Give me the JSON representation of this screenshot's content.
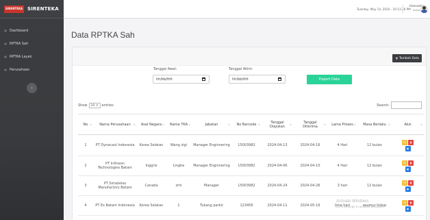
{
  "brand": {
    "logo_line1": "SIRENTEKA",
    "logo_line2": "",
    "name": "SIRENTEKA"
  },
  "sidebar": {
    "items": [
      {
        "label": "Dashboard",
        "icon": "circle-icon"
      },
      {
        "label": "RPTKA Sah",
        "icon": "circle-icon"
      },
      {
        "label": "RPTKA Layak",
        "icon": "circle-icon"
      },
      {
        "label": "Perusahaan",
        "icon": "circle-icon"
      }
    ],
    "collapse_glyph": "‹"
  },
  "topbar": {
    "date": "Tuesday, May 14, 2024 - 10:13:28 PM",
    "user_name": "Hasnadan",
    "user_role": "Admin"
  },
  "page": {
    "title": "Data RPTKA Sah"
  },
  "toolbar": {
    "add_label": "Tambah Data",
    "add_glyph": "+"
  },
  "filters": {
    "start_label": "Tanggal Awal:",
    "start_placeholder": "hh/bb/tttt",
    "end_label": "Tanggal Akhir:",
    "end_placeholder": "hh/bb/tttt",
    "export_label": "Export Data"
  },
  "table_controls": {
    "show_label": "Show",
    "entries_value": "10",
    "entries_label": "entries",
    "search_label": "Search:"
  },
  "table": {
    "headers": [
      "No",
      "Nama Perusahaan",
      "Asal Negara",
      "Nama TKA",
      "Jabatan",
      "No Barcode",
      "Tanggal Diajukan",
      "Tanggal Diterima",
      "Lama Proses",
      "Masa Berlaku",
      "Aksi"
    ],
    "rows": [
      [
        "1",
        "PT Dynacast Indonesia",
        "Korea Selatan",
        "Wang zigi",
        "Manager Enginnering",
        "15003982",
        "2024-04-13",
        "2024-04-16",
        "4 Hari",
        "12 bulan"
      ],
      [
        "2",
        "PT Infineon Technologies Batam",
        "Inggris",
        "Linghe",
        "Manager Enginnering",
        "15003982",
        "2024-04-06",
        "2024-04-10",
        "4 Hari",
        "12 bulan"
      ],
      [
        "3",
        "PT Simatelex Manufactory Batam",
        "Canada",
        "zml",
        "Manager",
        "15003982",
        "2024-04-24",
        "2024-04-26",
        "3 hari",
        "12 bulan"
      ],
      [
        "4",
        "PT Ex Batam Indonesia",
        "Korea Selatan",
        "1",
        "Tukang parkir",
        "123456",
        "2024-04-11",
        "2024-05-16",
        "lima hari",
        "seumur hidup"
      ]
    ]
  },
  "watermark": {
    "line1": "Activate Windows",
    "line2": "Go to Settings to activate Windows."
  },
  "colors": {
    "sidebar": "#3a3b3e",
    "export": "#2ad398",
    "edit": "#f5c243",
    "delete": "#e54645",
    "view": "#2b7de0"
  }
}
